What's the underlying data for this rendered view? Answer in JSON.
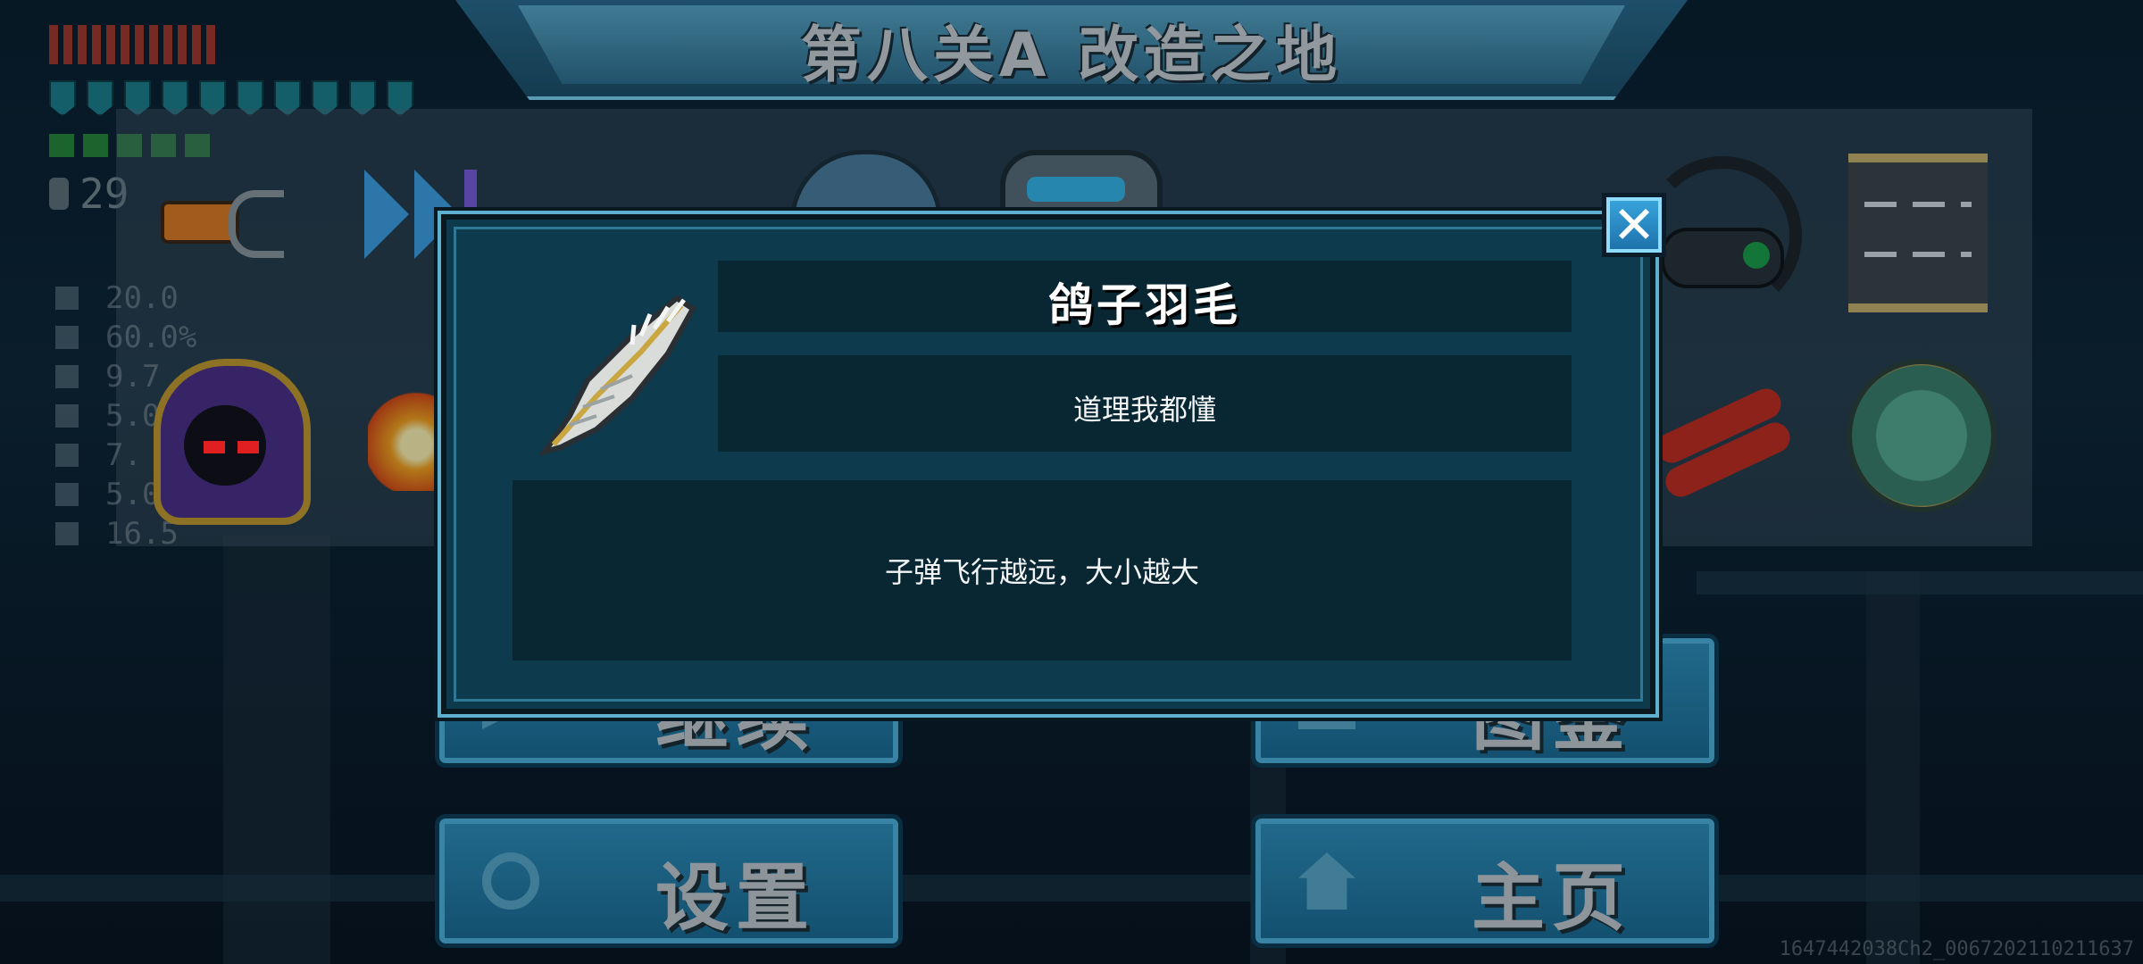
{
  "level_title": "第八关A  改造之地",
  "hud": {
    "coins": "29",
    "stats": [
      "20.0",
      "60.0%",
      "9.7",
      "5.0",
      "7.",
      "5.0",
      "16.5"
    ]
  },
  "menu": {
    "continue_label": "继续",
    "gallery_label": "图鉴",
    "settings_label": "设置",
    "home_label": "主页"
  },
  "dialog": {
    "item_name": "鸽子羽毛",
    "item_quote": "道理我都懂",
    "item_description": "子弹飞行越远，大小越大",
    "close_symbol": "✕",
    "item_icon": "feather-icon"
  },
  "watermark": "1647442038Ch2_0067202110211637",
  "colors": {
    "dialog_bg": "#0d3a4d",
    "panel_bg": "#082733",
    "button_blue": "#2f8fba",
    "close_blue": "#3aa6de"
  }
}
